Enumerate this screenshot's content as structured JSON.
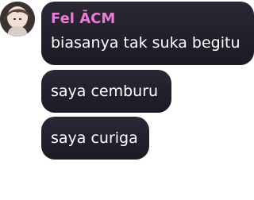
{
  "chat": {
    "sender": {
      "name": "Fel ĀCM",
      "name_color": "#e97cd4",
      "avatar": "user-avatar-photo"
    },
    "messages": [
      {
        "text": "biasanya tak suka begitu"
      },
      {
        "text": "saya cemburu"
      },
      {
        "text": "saya curiga"
      }
    ],
    "bubble_color": "#24212d",
    "text_color": "#ffffff"
  }
}
